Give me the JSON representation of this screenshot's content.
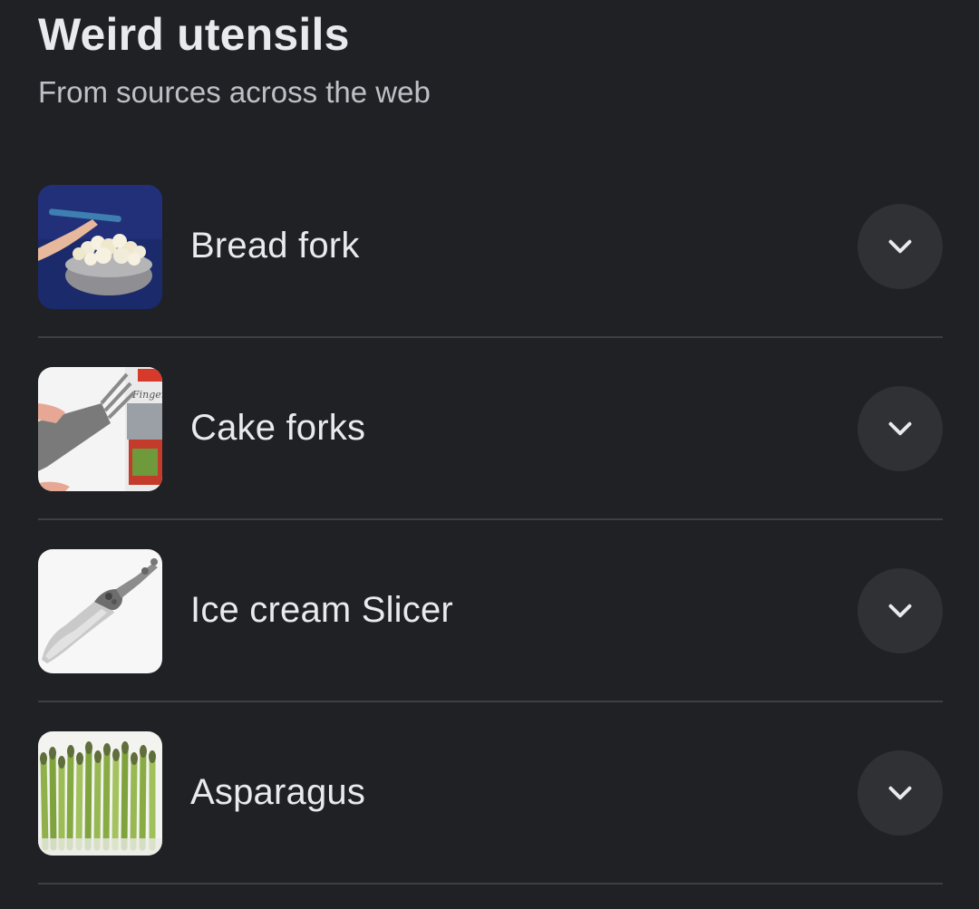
{
  "header": {
    "title": "Weird utensils",
    "subtitle": "From sources across the web"
  },
  "items": [
    {
      "label": "Bread fork",
      "icon": "chevron-down-icon"
    },
    {
      "label": "Cake forks",
      "icon": "chevron-down-icon"
    },
    {
      "label": "Ice cream Slicer",
      "icon": "chevron-down-icon"
    },
    {
      "label": "Asparagus",
      "icon": "chevron-down-icon"
    }
  ],
  "colors": {
    "background": "#202124",
    "text": "#e8eaed",
    "subtext": "#bdc1c6",
    "divider": "#3c4043",
    "button": "#303134"
  }
}
